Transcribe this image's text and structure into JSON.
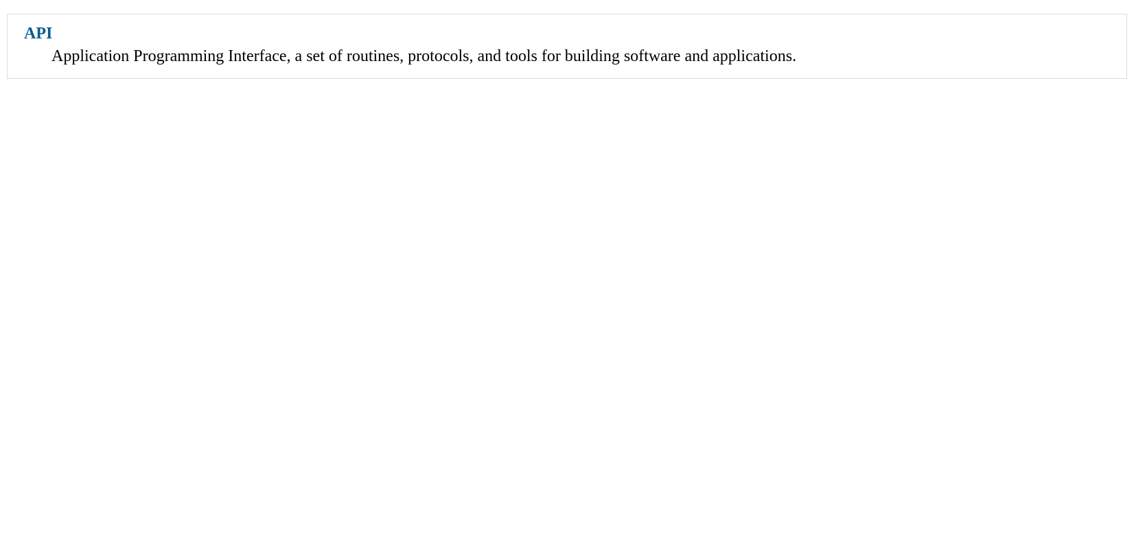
{
  "definition": {
    "term": "API",
    "description": "Application Programming Interface, a set of routines, protocols, and tools for building software and applications."
  }
}
